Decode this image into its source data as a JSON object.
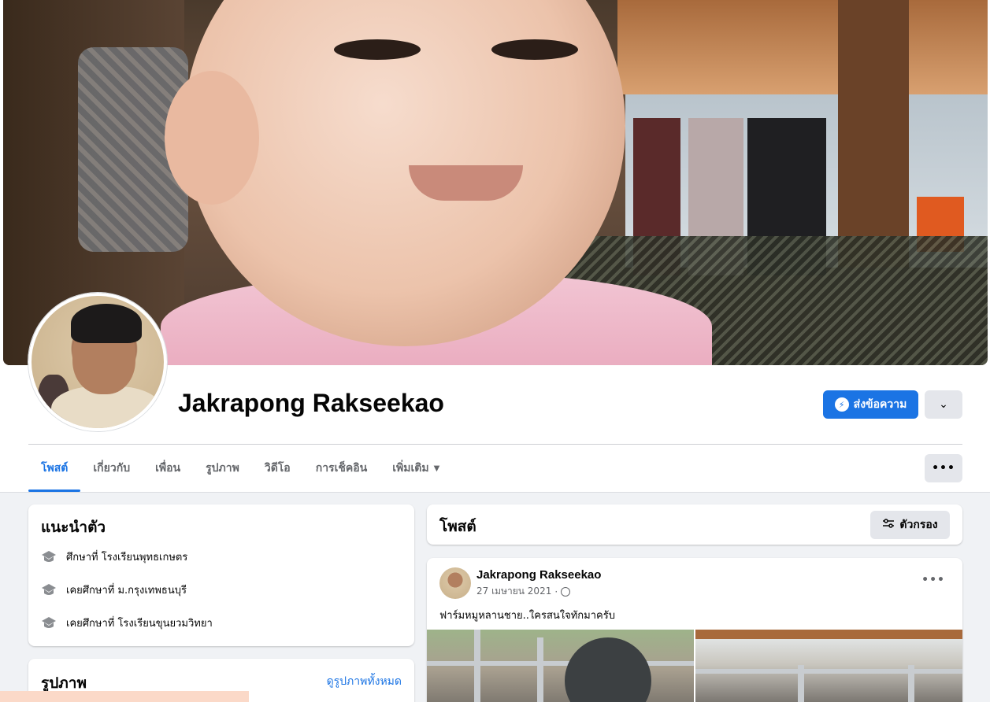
{
  "profile": {
    "name": "Jakrapong Rakseekao",
    "message_button": "ส่งข้อความ"
  },
  "tabs": [
    {
      "label": "โพสต์"
    },
    {
      "label": "เกี่ยวกับ"
    },
    {
      "label": "เพื่อน"
    },
    {
      "label": "รูปภาพ"
    },
    {
      "label": "วิดีโอ"
    },
    {
      "label": "การเช็คอิน"
    },
    {
      "label": "เพิ่มเติม"
    }
  ],
  "intro": {
    "title": "แนะนำตัว",
    "items": [
      {
        "icon": "graduation-cap-icon",
        "text": "ศึกษาที่ โรงเรียนพุทธเกษตร"
      },
      {
        "icon": "graduation-cap-icon",
        "text": "เคยศึกษาที่ ม.กรุงเทพธนบุรี"
      },
      {
        "icon": "graduation-cap-icon",
        "text": "เคยศึกษาที่ โรงเรียนขุนยวมวิทยา"
      }
    ]
  },
  "photos": {
    "title": "รูปภาพ",
    "see_all": "ดูรูปภาพทั้งหมด"
  },
  "posts": {
    "title": "โพสต์",
    "filter_button": "ตัวกรอง"
  },
  "post": {
    "author": "Jakrapong Rakseekao",
    "date": "27 เมษายน 2021",
    "separator": "·",
    "text": "ฟาร์มหมูหลานชาย..ใครสนใจทักมาครับ"
  },
  "colors": {
    "accent": "#1b74e4",
    "background": "#f0f2f5",
    "secondary_button": "#e4e6eb"
  }
}
